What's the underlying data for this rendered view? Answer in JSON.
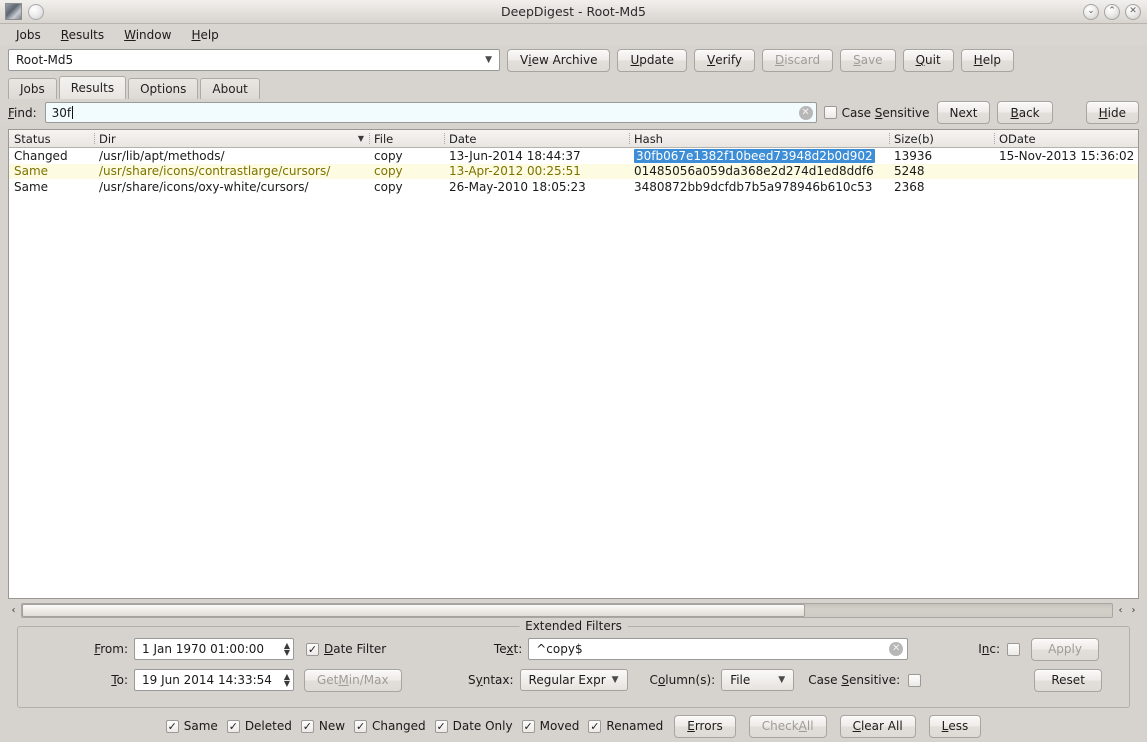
{
  "window": {
    "title": "DeepDigest - Root-Md5",
    "app_icon": "app-icon",
    "menu_icon": "window-menu-icon",
    "minimize": "⌄",
    "maximize": "⌃",
    "close": "✕"
  },
  "menubar": [
    {
      "label": "Jobs",
      "accel": "J"
    },
    {
      "label": "Results",
      "accel": "R"
    },
    {
      "label": "Window",
      "accel": "W"
    },
    {
      "label": "Help",
      "accel": "H"
    }
  ],
  "toolbar": {
    "job_combo_value": "Root-Md5",
    "buttons": [
      {
        "label": "View Archive",
        "accel": "i",
        "disabled": false
      },
      {
        "label": "Update",
        "accel": "U",
        "disabled": false
      },
      {
        "label": "Verify",
        "accel": "V",
        "disabled": false
      },
      {
        "label": "Discard",
        "accel": "D",
        "disabled": true
      },
      {
        "label": "Save",
        "accel": "S",
        "disabled": true
      },
      {
        "label": "Quit",
        "accel": "Q",
        "disabled": false
      },
      {
        "label": "Help",
        "accel": "H",
        "disabled": false
      }
    ]
  },
  "tabs": [
    {
      "label": "Jobs",
      "active": false
    },
    {
      "label": "Results",
      "active": true
    },
    {
      "label": "Options",
      "active": false
    },
    {
      "label": "About",
      "active": false
    }
  ],
  "findbar": {
    "label": "Find:",
    "value": "30f",
    "placeholder": "",
    "clear_icon": "clear-icon",
    "case_sensitive_label": "Case Sensitive",
    "case_sensitive_checked": false,
    "next_label": "Next",
    "back_label": "Back",
    "hide_label": "Hide"
  },
  "table": {
    "columns": [
      {
        "key": "status",
        "label": "Status",
        "sorted": false
      },
      {
        "key": "dir",
        "label": "Dir",
        "sorted": true,
        "sort_arrow": "⌄"
      },
      {
        "key": "file",
        "label": "File",
        "sorted": false
      },
      {
        "key": "date",
        "label": "Date",
        "sorted": false
      },
      {
        "key": "hash",
        "label": "Hash",
        "sorted": false
      },
      {
        "key": "size",
        "label": "Size(b)",
        "sorted": false
      },
      {
        "key": "odate",
        "label": "ODate",
        "sorted": false
      }
    ],
    "rows": [
      {
        "status": "Changed",
        "dir": "/usr/lib/apt/methods/",
        "file": "copy",
        "date": "13-Jun-2014 18:44:37",
        "hash": "30fb067e1382f10beed73948d2b0d902",
        "hash_selected": true,
        "size": "13936",
        "odate": "15-Nov-2013 15:36:02",
        "alt": false
      },
      {
        "status": "Same",
        "dir": "/usr/share/icons/contrastlarge/cursors/",
        "file": "copy",
        "date": "13-Apr-2012 00:25:51",
        "hash": "01485056a059da368e2d274d1ed8ddf6",
        "hash_selected": false,
        "size": "5248",
        "odate": "",
        "alt": true
      },
      {
        "status": "Same",
        "dir": "/usr/share/icons/oxy-white/cursors/",
        "file": "copy",
        "date": "26-May-2010 18:05:23",
        "hash": "3480872bb9dcfdb7b5a978946b610c53",
        "hash_selected": false,
        "size": "2368",
        "odate": "",
        "alt": false
      }
    ]
  },
  "scrollbar": {
    "left_arrow": "‹",
    "right_arrow_1": "‹",
    "right_arrow_2": "›"
  },
  "filters": {
    "group_label": "Extended Filters",
    "from_label": "From:",
    "from_value": "1 Jan 1970 01:00:00",
    "to_label": "To:",
    "to_value": "19 Jun 2014 14:33:54",
    "date_filter_label": "Date Filter",
    "date_filter_checked": true,
    "get_min_max_label": "Get Min/Max",
    "get_min_max_disabled": true,
    "text_label": "Text:",
    "text_value": "^copy$",
    "text_clear_icon": "clear-icon",
    "syntax_label": "Syntax:",
    "syntax_value": "Regular Expr",
    "columns_label": "Column(s):",
    "columns_value": "File",
    "case_sensitive_label": "Case Sensitive:",
    "case_sensitive_checked": false,
    "inc_label": "Inc:",
    "inc_checked": false,
    "apply_label": "Apply",
    "apply_disabled": true,
    "reset_label": "Reset"
  },
  "statusbar": {
    "checkboxes": [
      {
        "label": "Same",
        "checked": true
      },
      {
        "label": "Deleted",
        "checked": true
      },
      {
        "label": "New",
        "checked": true
      },
      {
        "label": "Changed",
        "checked": true
      },
      {
        "label": "Date Only",
        "checked": true
      },
      {
        "label": "Moved",
        "checked": true
      },
      {
        "label": "Renamed",
        "checked": true
      }
    ],
    "errors_label": "Errors",
    "check_all_label": "Check All",
    "check_all_disabled": true,
    "clear_all_label": "Clear All",
    "less_label": "Less"
  },
  "colors": {
    "selection_blue": "#3d8ed6",
    "alt_row_bg": "#fdfce2",
    "alt_row_fg": "#7d7200",
    "window_bg": "#d6d2cd",
    "find_field_bg": "#f2fbfd"
  }
}
